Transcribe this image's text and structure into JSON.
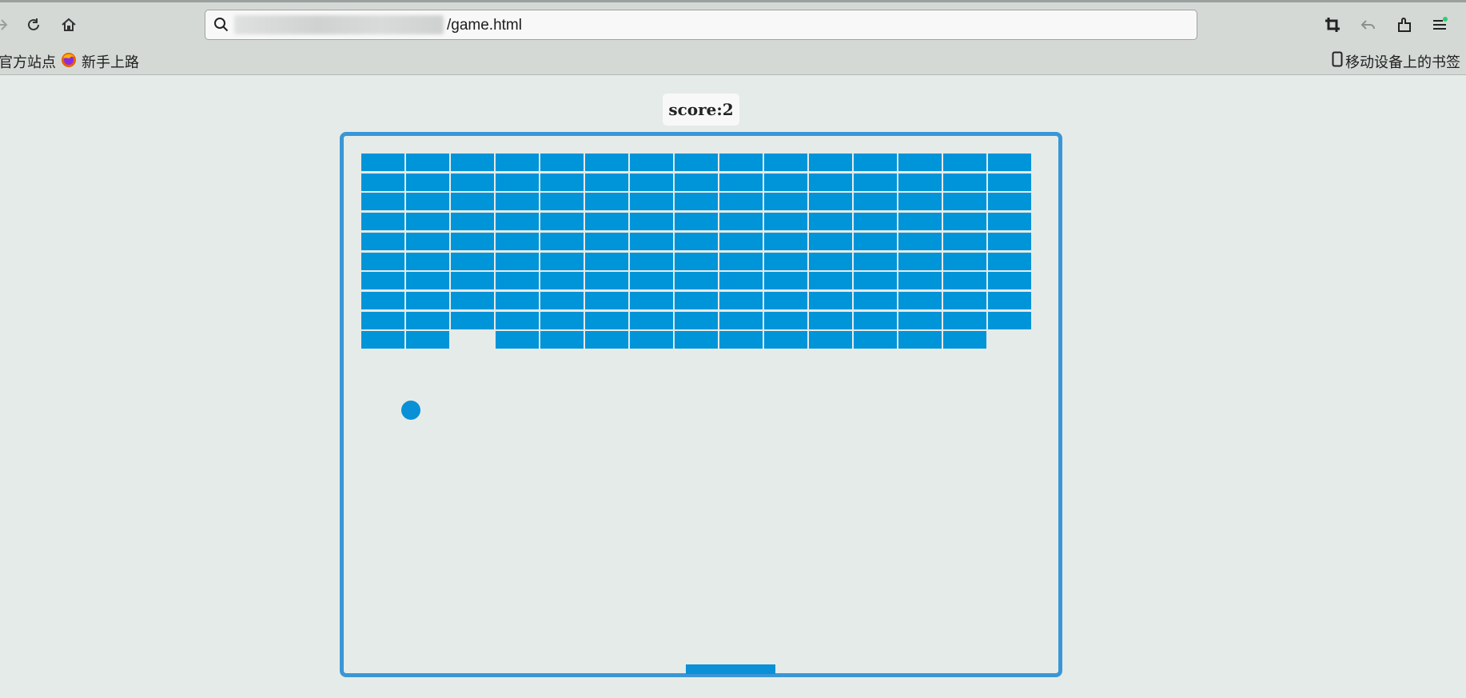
{
  "browser": {
    "url_suffix": "/game.html",
    "icons": [
      "forward-icon",
      "reload-icon",
      "home-icon",
      "search-icon",
      "crop-icon",
      "undo-icon",
      "extensions-icon",
      "menu-icon"
    ],
    "bookmarks": [
      {
        "label": "官方站点"
      },
      {
        "label": "新手上路"
      }
    ],
    "mobile_bookmarks": "移动设备上的书签"
  },
  "game": {
    "score_label": "score:2",
    "score": 2,
    "brick_color": "#0094d9",
    "frame_color": "#3a96d6",
    "grid": {
      "columns": 15,
      "rows": [
        "111111111111111",
        "111111111111111",
        "111111111111111",
        "111111111111111",
        "111111111111111",
        "111111111111111",
        "111111111111111",
        "111111111111111",
        "111111111111111",
        "110111111111110"
      ]
    }
  }
}
